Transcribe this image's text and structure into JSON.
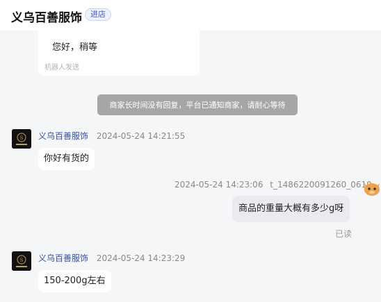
{
  "header": {
    "shop_name": "义乌百善服饰",
    "enter_label": "进店"
  },
  "messages": {
    "bot_reply": {
      "text": "您好，稍等",
      "sub": "机器人发送"
    },
    "system_notice": "商家长时间没有回复，平台已通知商家，请耐心等待",
    "msg1": {
      "sender": "义乌百善服饰",
      "time": "2024-05-24 14:21:55",
      "text": "你好有货的"
    },
    "msg2": {
      "time": "2024-05-24 14:23:06",
      "sender": "t_1486220091260_0619",
      "text": "商品的重量大概有多少g呀",
      "status": "已读"
    },
    "msg3": {
      "sender": "义乌百善服饰",
      "time": "2024-05-24 14:23:29",
      "text": "150-200g左右"
    }
  },
  "colors": {
    "merchant_name": "#3550a8",
    "notice_bg": "#a6a6a6",
    "enter_button": "#3b5bd6"
  },
  "icons": {
    "shop_avatar": "shop-logo-icon",
    "customer_avatar": "cartoon-animal-avatar-icon"
  }
}
